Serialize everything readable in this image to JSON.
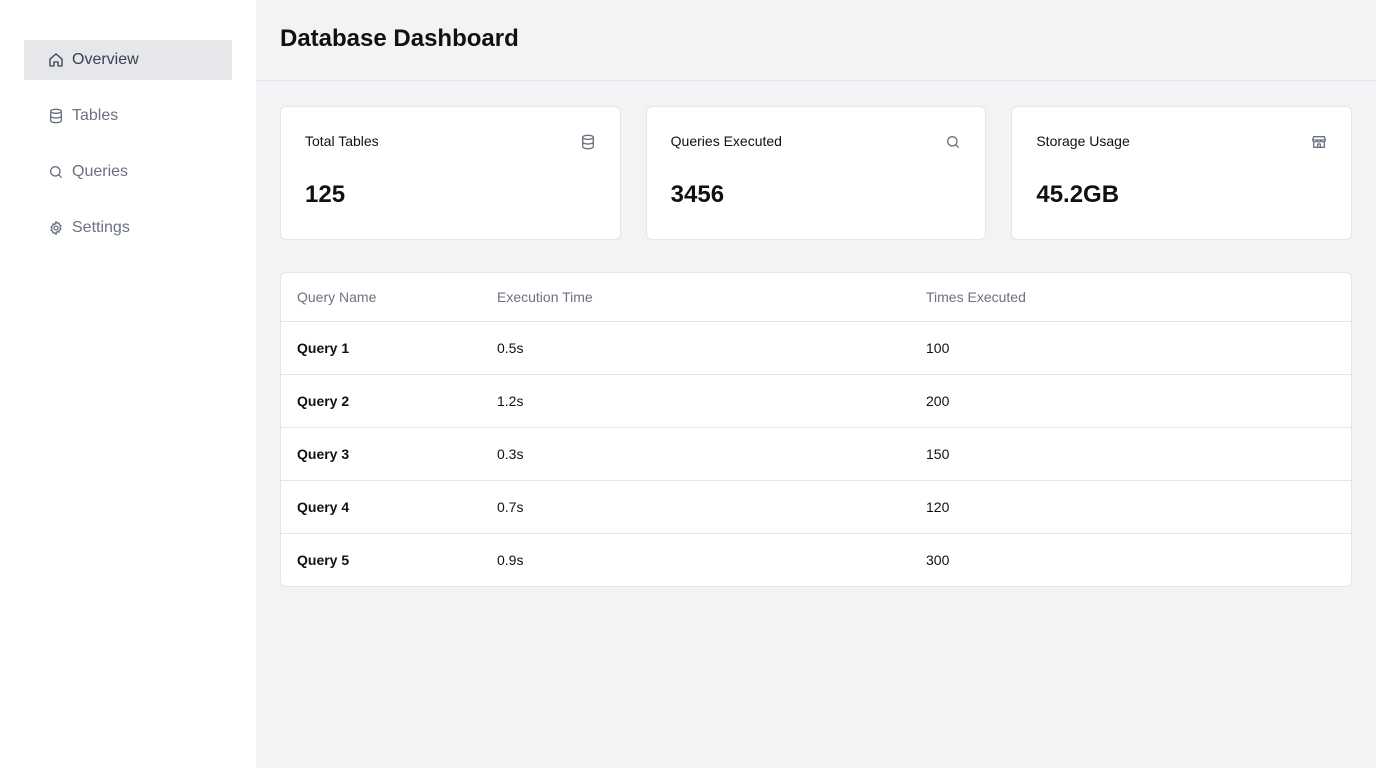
{
  "sidebar": {
    "items": [
      {
        "label": "Overview",
        "icon": "home-icon",
        "active": true
      },
      {
        "label": "Tables",
        "icon": "database-icon",
        "active": false
      },
      {
        "label": "Queries",
        "icon": "search-icon",
        "active": false
      },
      {
        "label": "Settings",
        "icon": "gear-icon",
        "active": false
      }
    ]
  },
  "header": {
    "title": "Database Dashboard"
  },
  "stats": [
    {
      "title": "Total Tables",
      "value": "125",
      "icon": "database-icon"
    },
    {
      "title": "Queries Executed",
      "value": "3456",
      "icon": "search-icon"
    },
    {
      "title": "Storage Usage",
      "value": "45.2GB",
      "icon": "store-icon"
    }
  ],
  "table": {
    "headers": [
      "Query Name",
      "Execution Time",
      "Times Executed"
    ],
    "rows": [
      [
        "Query 1",
        "0.5s",
        "100"
      ],
      [
        "Query 2",
        "1.2s",
        "200"
      ],
      [
        "Query 3",
        "0.3s",
        "150"
      ],
      [
        "Query 4",
        "0.7s",
        "120"
      ],
      [
        "Query 5",
        "0.9s",
        "300"
      ]
    ]
  },
  "colors": {
    "sidebar_bg": "#ffffff",
    "main_bg": "#f2f3f5",
    "active_item_bg": "#e5e7eb",
    "muted_text": "#6b7280",
    "border": "#e3e5e8"
  }
}
